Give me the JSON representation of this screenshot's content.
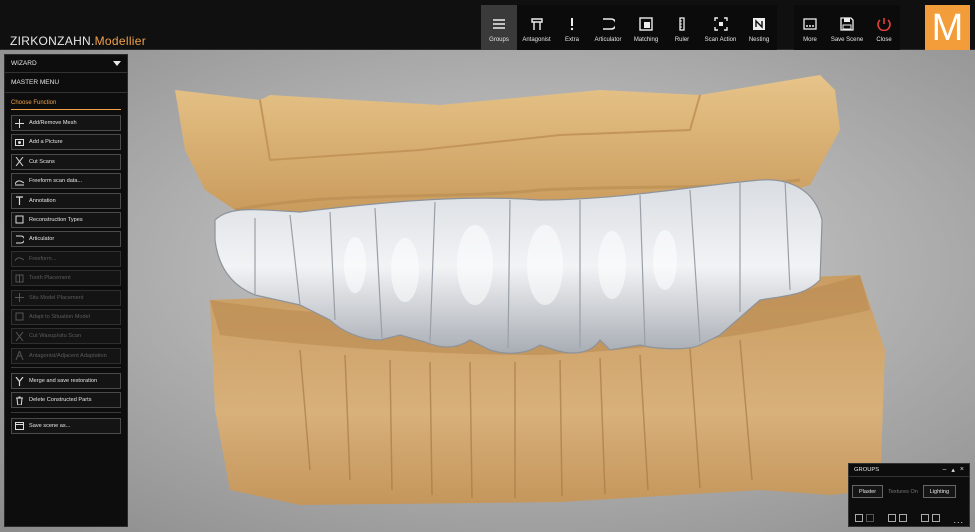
{
  "app": {
    "brand_main": "ZIRKONZAHN.",
    "brand_accent": "Modellier",
    "logo_letter": "M"
  },
  "toolbar": {
    "main": [
      {
        "label": "Groups",
        "icon": "menu-lines-icon",
        "active": true
      },
      {
        "label": "Antagonist",
        "icon": "antagonist-icon"
      },
      {
        "label": "Extra",
        "icon": "exclamation-icon"
      },
      {
        "label": "Articulator",
        "icon": "articulator-icon"
      },
      {
        "label": "Matching",
        "icon": "matching-icon"
      },
      {
        "label": "Ruler",
        "icon": "ruler-icon"
      },
      {
        "label": "Scan Action",
        "icon": "scan-action-icon"
      },
      {
        "label": "Nesting",
        "icon": "nesting-icon"
      }
    ],
    "right": [
      {
        "label": "More",
        "icon": "more-icon"
      },
      {
        "label": "Save Scene",
        "icon": "save-icon"
      },
      {
        "label": "Close",
        "icon": "power-icon"
      }
    ]
  },
  "sidebar": {
    "wizard": "WIZARD",
    "master_menu": "MASTER MENU",
    "choose_function": "Choose Function",
    "buttons": [
      {
        "label": "Add/Remove Mesh",
        "icon": "plus-minus-icon",
        "enabled": true
      },
      {
        "label": "Add a Picture",
        "icon": "picture-icon",
        "enabled": true
      },
      {
        "label": "Cut Scans",
        "icon": "scissors-icon",
        "enabled": true
      },
      {
        "label": "Freeform scan data...",
        "icon": "freeform-icon",
        "enabled": true
      },
      {
        "label": "Annotation",
        "icon": "pin-icon",
        "enabled": true
      },
      {
        "label": "Reconstruction Types",
        "icon": "tooth-icon",
        "enabled": true
      },
      {
        "label": "Articulator",
        "icon": "articulator-icon",
        "enabled": true
      },
      {
        "label": "Freeform...",
        "icon": "freeform-icon",
        "enabled": false
      },
      {
        "label": "Tooth Placement",
        "icon": "tooth-placement-icon",
        "enabled": false
      },
      {
        "label": "Situ Model Placement",
        "icon": "move-icon",
        "enabled": false
      },
      {
        "label": "Adapt to Situation Model",
        "icon": "adapt-icon",
        "enabled": false
      },
      {
        "label": "Cut Waxup/situ Scan",
        "icon": "scissors-icon",
        "enabled": false
      },
      {
        "label": "Antagonist/Adjacent Adaptation",
        "icon": "antagonist-icon",
        "enabled": false
      }
    ],
    "buttons2": [
      {
        "label": "Merge and save restoration",
        "icon": "merge-icon",
        "enabled": true
      },
      {
        "label": "Delete Constructed Parts",
        "icon": "trash-icon",
        "enabled": true
      }
    ],
    "buttons3": [
      {
        "label": "Save scene as...",
        "icon": "calendar-save-icon",
        "enabled": true
      }
    ]
  },
  "groups_panel": {
    "title": "GROUPS",
    "plaster": "Plaster",
    "textures": "Textures On",
    "lighting": "Lighting",
    "more": "..."
  },
  "colors": {
    "accent": "#f39c3a",
    "plaster": "#d9b57a",
    "teeth": "#e4e7ea"
  }
}
